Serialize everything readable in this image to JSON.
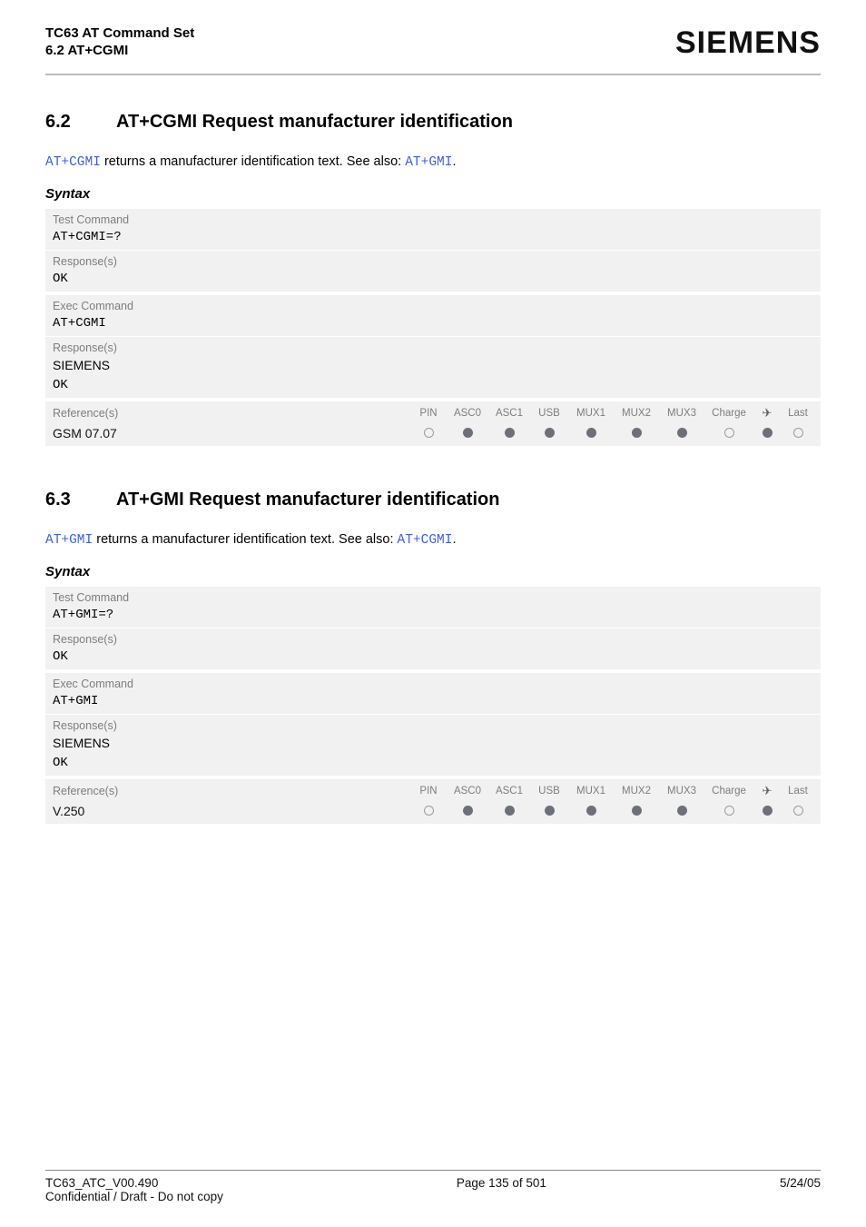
{
  "header": {
    "title": "TC63 AT Command Set",
    "subtitle": "6.2 AT+CGMI",
    "logo": "SIEMENS"
  },
  "sections": [
    {
      "num": "6.2",
      "title": "AT+CGMI   Request manufacturer identification",
      "desc_prefix": "AT+CGMI",
      "desc_mid": " returns a manufacturer identification text. See also: ",
      "desc_link": "AT+GMI",
      "desc_suffix": ".",
      "syntax_label": "Syntax",
      "test_command_label": "Test Command",
      "test_command": "AT+CGMI=?",
      "test_response_label": "Response(s)",
      "test_response": "OK",
      "exec_command_label": "Exec Command",
      "exec_command": "AT+CGMI",
      "exec_response_label": "Response(s)",
      "exec_response_1": "SIEMENS",
      "exec_response_2": "OK",
      "reference_label": "Reference(s)",
      "reference_value": "GSM 07.07",
      "cols": {
        "c1": "PIN",
        "c2": "ASC0",
        "c3": "ASC1",
        "c4": "USB",
        "c5": "MUX1",
        "c6": "MUX2",
        "c7": "MUX3",
        "c8": "Charge",
        "c9": "✈",
        "c10": "Last"
      },
      "vals": {
        "c1": "empty",
        "c2": "filled",
        "c3": "filled",
        "c4": "filled",
        "c5": "filled",
        "c6": "filled",
        "c7": "filled",
        "c8": "empty",
        "c9": "filled",
        "c10": "empty"
      }
    },
    {
      "num": "6.3",
      "title": "AT+GMI   Request manufacturer identification",
      "desc_prefix": "AT+GMI",
      "desc_mid": " returns a manufacturer identification text. See also: ",
      "desc_link": "AT+CGMI",
      "desc_suffix": ".",
      "syntax_label": "Syntax",
      "test_command_label": "Test Command",
      "test_command": "AT+GMI=?",
      "test_response_label": "Response(s)",
      "test_response": "OK",
      "exec_command_label": "Exec Command",
      "exec_command": "AT+GMI",
      "exec_response_label": "Response(s)",
      "exec_response_1": "SIEMENS",
      "exec_response_2": "OK",
      "reference_label": "Reference(s)",
      "reference_value": "V.250",
      "cols": {
        "c1": "PIN",
        "c2": "ASC0",
        "c3": "ASC1",
        "c4": "USB",
        "c5": "MUX1",
        "c6": "MUX2",
        "c7": "MUX3",
        "c8": "Charge",
        "c9": "✈",
        "c10": "Last"
      },
      "vals": {
        "c1": "empty",
        "c2": "filled",
        "c3": "filled",
        "c4": "filled",
        "c5": "filled",
        "c6": "filled",
        "c7": "filled",
        "c8": "empty",
        "c9": "filled",
        "c10": "empty"
      }
    }
  ],
  "footer": {
    "left_line1": "TC63_ATC_V00.490",
    "left_line2": "Confidential / Draft - Do not copy",
    "center": "Page 135 of 501",
    "right": "5/24/05"
  }
}
